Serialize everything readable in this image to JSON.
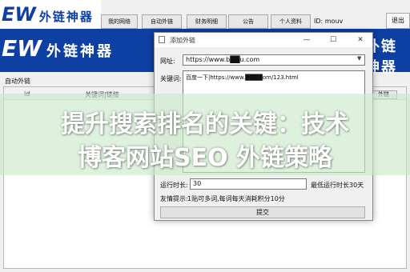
{
  "app": {
    "logo_latin": "EW",
    "logo_cn": "外链神器",
    "user_id_text": "ID: mouv",
    "exit_label": "退出",
    "tabs": [
      {
        "label": "我的网络"
      },
      {
        "label": "自动外链"
      },
      {
        "label": "财务明细"
      },
      {
        "label": "公告"
      },
      {
        "label": "个人资料"
      }
    ],
    "group_label": "自动外链",
    "grid_headers": [
      "id",
      "关键词|链接"
    ],
    "grid_button": "外链"
  },
  "dialog": {
    "title": "添加外链",
    "url_label": "网址:",
    "url_value": "https://www.b██u.com",
    "keyword_label": "关键词:",
    "keyword_value": "百度一下|https://www.████om/123.html",
    "time_label": "运行时长:",
    "time_value": "30",
    "time_hint": "最低运行时长30天",
    "tip_label": "友情提示:",
    "tip_text": "1贴可多词,每词每天消耗积分10分",
    "submit_label": "提交"
  },
  "overlay": {
    "line1": "提升搜索排名的关键：技术",
    "line2": "博客网站SEO 外链策略"
  }
}
